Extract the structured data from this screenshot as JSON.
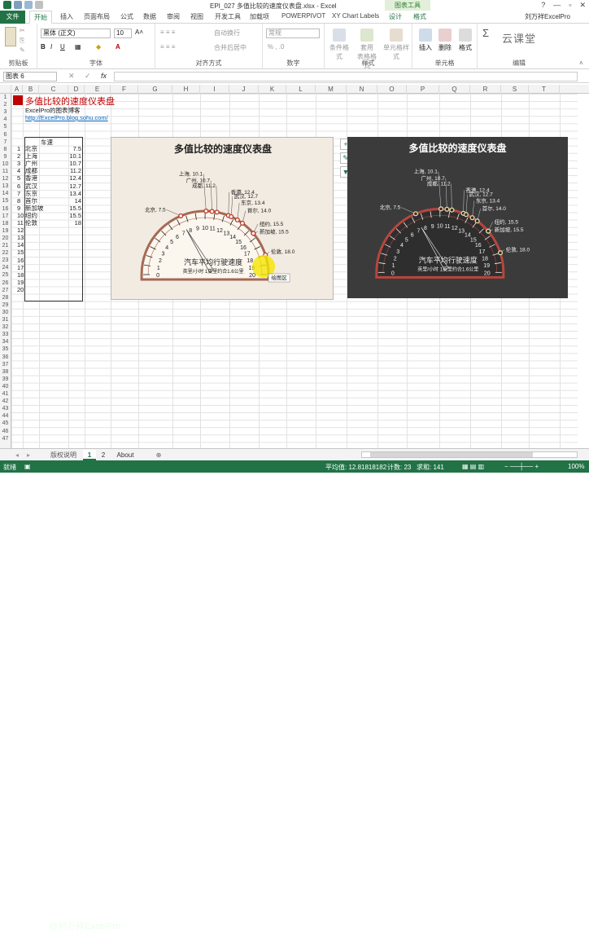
{
  "app": {
    "document_title": "EPI_027 多值比较的速度仪表盘.xlsx - Excel",
    "context_tools": "图表工具",
    "user": "刘万祥ExcelPro",
    "window_controls": [
      "?",
      "—",
      "▫",
      "✕"
    ]
  },
  "tabs": [
    "文件",
    "开始",
    "插入",
    "页面布局",
    "公式",
    "数据",
    "审阅",
    "视图",
    "开发工具",
    "加载项",
    "POWERPIVOT",
    "XY Chart Labels",
    "设计",
    "格式"
  ],
  "ribbon": {
    "groups": [
      "剪贴板",
      "字体",
      "对齐方式",
      "数字",
      "样式",
      "单元格",
      "编辑"
    ],
    "font_name": "黑体 (正文)",
    "font_size": "10",
    "wrap_text": "自动换行",
    "merge_center": "合并后居中",
    "number_format": "常规",
    "conditional_format": "条件格式",
    "table_format": "套用\n表格格式",
    "cell_styles": "单元格样式",
    "insert": "插入",
    "delete": "删除",
    "format": "格式",
    "overlay_brand": "云课堂"
  },
  "formula_bar": {
    "name_box": "图表 6",
    "fx": "fx",
    "cancel": "✕",
    "enter": "✓",
    "formula": ""
  },
  "columns": [
    "A",
    "B",
    "C",
    "D",
    "E",
    "F",
    "G",
    "H",
    "I",
    "J",
    "K",
    "L",
    "M",
    "N",
    "O",
    "P",
    "Q",
    "R",
    "S",
    "T"
  ],
  "rows": [
    "1",
    "2",
    "3",
    "4",
    "5",
    "6",
    "7",
    "8",
    "9",
    "10",
    "11",
    "12",
    "13",
    "14",
    "15",
    "16",
    "17",
    "18",
    "19",
    "20",
    "21",
    "22",
    "23",
    "24",
    "25",
    "26",
    "27",
    "28",
    "29",
    "30",
    "31",
    "32",
    "33",
    "34",
    "35",
    "36",
    "37",
    "38",
    "39",
    "40",
    "41",
    "42",
    "43",
    "44",
    "45",
    "46",
    "47"
  ],
  "sheet": {
    "title": "多值比较的速度仪表盘",
    "subtitle": "ExcelPro的图表博客",
    "link": "http://ExcelPro.blog.sohu.com/",
    "table_header": "车速",
    "table_rows": [
      {
        "i": "1",
        "city": "北京",
        "val": "7.5"
      },
      {
        "i": "2",
        "city": "上海",
        "val": "10.1"
      },
      {
        "i": "3",
        "city": "广州",
        "val": "10.7"
      },
      {
        "i": "4",
        "city": "成都",
        "val": "11.2"
      },
      {
        "i": "5",
        "city": "香港",
        "val": "12.4"
      },
      {
        "i": "6",
        "city": "武汉",
        "val": "12.7"
      },
      {
        "i": "7",
        "city": "东京",
        "val": "13.4"
      },
      {
        "i": "8",
        "city": "首尔",
        "val": "14"
      },
      {
        "i": "9",
        "city": "新加坡",
        "val": "15.5"
      },
      {
        "i": "10",
        "city": "纽约",
        "val": "15.5"
      },
      {
        "i": "11",
        "city": "伦敦",
        "val": "18"
      },
      {
        "i": "12",
        "city": "",
        "val": ""
      },
      {
        "i": "13",
        "city": "",
        "val": ""
      },
      {
        "i": "14",
        "city": "",
        "val": ""
      },
      {
        "i": "15",
        "city": "",
        "val": ""
      },
      {
        "i": "16",
        "city": "",
        "val": ""
      },
      {
        "i": "17",
        "city": "",
        "val": ""
      },
      {
        "i": "18",
        "city": "",
        "val": ""
      },
      {
        "i": "19",
        "city": "",
        "val": ""
      },
      {
        "i": "20",
        "city": "",
        "val": ""
      }
    ]
  },
  "gauge": {
    "title": "多值比较的速度仪表盘",
    "center_label": "汽车平均行驶速度",
    "unit_label": "英里/小时  1英里约合1.6公里",
    "scale_min": 0,
    "scale_max": 20,
    "ticks": [
      "0",
      "1",
      "2",
      "3",
      "4",
      "5",
      "6",
      "7",
      "8",
      "9",
      "10",
      "11",
      "12",
      "13",
      "14",
      "15",
      "16",
      "17",
      "18",
      "19",
      "20"
    ],
    "points": [
      {
        "label": "北京, 7.5",
        "value": 7.5
      },
      {
        "label": "上海, 10.1",
        "value": 10.1
      },
      {
        "label": "广州, 10.7",
        "value": 10.7
      },
      {
        "label": "成都, 11.2",
        "value": 11.2
      },
      {
        "label": "香港, 12.4",
        "value": 12.4
      },
      {
        "label": "武汉, 12.7",
        "value": 12.7
      },
      {
        "label": "东京, 13.4",
        "value": 13.4
      },
      {
        "label": "首尔, 14.0",
        "value": 14.0
      },
      {
        "label": "纽约, 15.5",
        "value": 15.5
      },
      {
        "label": "新加坡, 15.5",
        "value": 15.5
      },
      {
        "label": "伦敦, 18.0",
        "value": 18.0
      }
    ],
    "needle_value": 7.5,
    "tooltip": "绘图区",
    "light": {
      "bg": "#f2ebe1",
      "dial": "#fbf6ee",
      "rim": "#a46a55",
      "text": "#222222",
      "point": "#c0392b",
      "title": "#222222"
    },
    "dark": {
      "bg": "#3b3b3b",
      "dial": "#2e2e2e",
      "rim": "#b8463e",
      "text": "#f1f1f1",
      "point": "#e8d9a6",
      "title": "#ffffff"
    }
  },
  "chart_side_buttons": [
    "+",
    "✎",
    "▼"
  ],
  "sheet_tabs": [
    "版权说明",
    "1",
    "2",
    "About",
    "⊕"
  ],
  "active_sheet": "1",
  "status": {
    "ready": "就绪",
    "watermark": "@刘万祥ExcelPro",
    "average": "平均值: 12.81818182",
    "count": "计数: 23",
    "sum": "求和: 141",
    "zoom": "100%"
  },
  "colors": {
    "excel_green": "#217346",
    "accent_red": "#c00000",
    "link": "#0563c1"
  }
}
